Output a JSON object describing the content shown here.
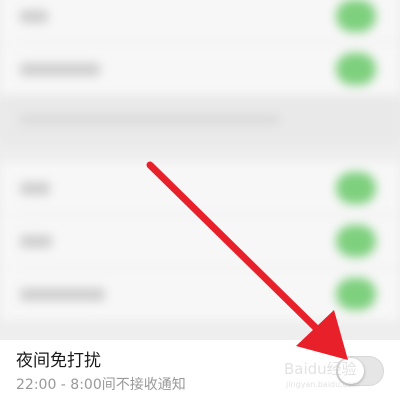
{
  "dnd_setting": {
    "title": "夜间免打扰",
    "subtitle": "22:00 - 8:00间不接收通知",
    "enabled": false
  },
  "watermark": {
    "brand": "Baidu经验",
    "domain": "jingyan.baidu.com"
  },
  "colors": {
    "toggle_on": "#7ed07e",
    "toggle_off": "#e6e6e6",
    "arrow": "#e8202a"
  },
  "icons": {
    "annotation": "red-arrow-icon"
  }
}
